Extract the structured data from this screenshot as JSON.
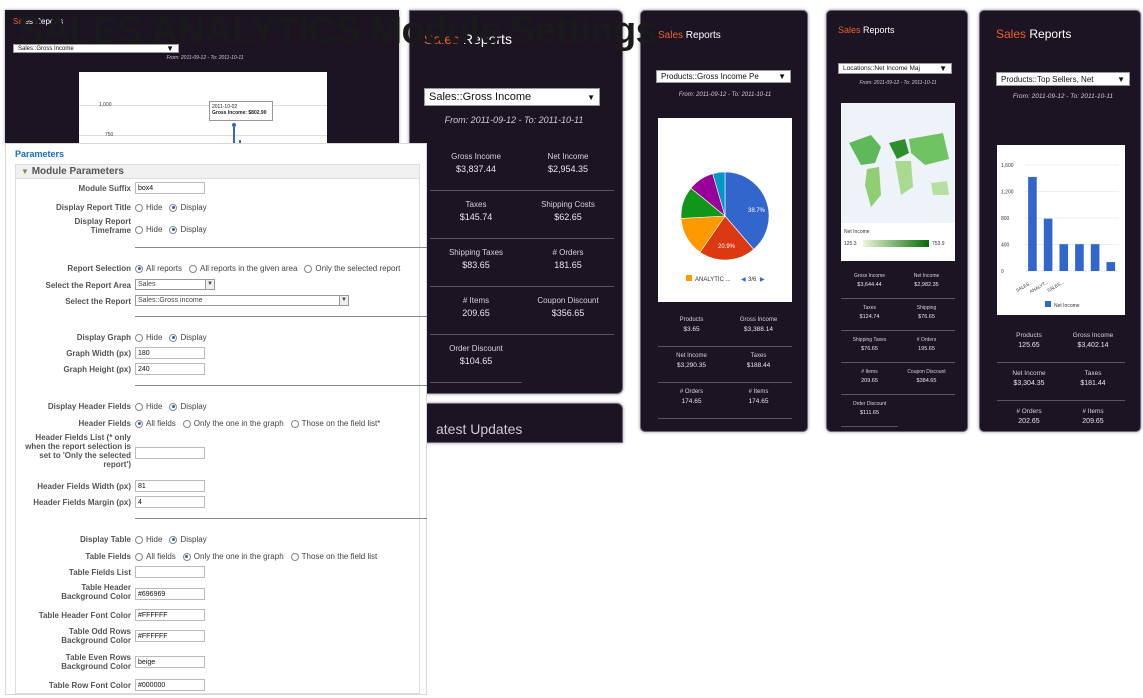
{
  "page_title": "SALES ANALYTICS Module Settings",
  "shot1": {
    "title_accent": "Sal",
    "title_rest": "es Reports",
    "select": "Sales::Gross Income",
    "range": "From: 2011-09-12 - To: 2011-10-11",
    "y_tick_1": "1,000",
    "y_tick_2": "750",
    "tooltip_date": "2011-10-02",
    "tooltip_value": "Gross Income: $802.90"
  },
  "shot2": {
    "title_accent": "Sales",
    "title_rest": "Reports",
    "select": "Sales::Gross Income",
    "range": "From: 2011-09-12 - To: 2011-10-11",
    "stats": [
      {
        "label": "Gross Income",
        "value": "$3,837.44"
      },
      {
        "label": "Net Income",
        "value": "$2,954.35"
      },
      {
        "label": "Taxes",
        "value": "$145.74"
      },
      {
        "label": "Shipping Costs",
        "value": "$62.65"
      },
      {
        "label": "Shipping Taxes",
        "value": "$83.65"
      },
      {
        "label": "# Orders",
        "value": "181.65"
      },
      {
        "label": "# Items",
        "value": "209.65"
      },
      {
        "label": "Coupon Discount",
        "value": "$356.65"
      },
      {
        "label": "Order Discount",
        "value": "$104.65"
      }
    ],
    "next_title": "atest Updates"
  },
  "shot3": {
    "title_accent": "Sales",
    "title_rest": "Reports",
    "select": "Products::Gross Income Pe",
    "range": "From: 2011-09-12 - To: 2011-10-11",
    "pie_label_1": "38.7%",
    "pie_label_2": "20.9%",
    "legend": "ANALYTIC ...",
    "pager": "3/6",
    "pie_colors": [
      "#3366cc",
      "#dc3912",
      "#ff9900",
      "#109618",
      "#990099",
      "#0099c6"
    ],
    "stats": [
      {
        "label": "Products",
        "value": "$3.65"
      },
      {
        "label": "Gross Income",
        "value": "$3,388.14"
      },
      {
        "label": "Net Income",
        "value": "$3,290.35"
      },
      {
        "label": "Taxes",
        "value": "$188.44"
      },
      {
        "label": "# Orders",
        "value": "174.65"
      },
      {
        "label": "# Items",
        "value": "174.65"
      }
    ]
  },
  "shot4": {
    "title_accent": "Sales",
    "title_rest": "Reports",
    "select": "Locations::Net Income Maj",
    "range": "From: 2011-09-12 - To: 2011-10-11",
    "map_legend_title": "Net Income",
    "map_min": "125.3",
    "map_max": "753.9",
    "stats": [
      {
        "label": "Gross Income",
        "value": "$3,644.44"
      },
      {
        "label": "Net Income",
        "value": "$2,982.35"
      },
      {
        "label": "Taxes",
        "value": "$124.74"
      },
      {
        "label": "Shipping",
        "value": "$76.65"
      },
      {
        "label": "Shipping Taxes",
        "value": "$76.65"
      },
      {
        "label": "# Orders",
        "value": "195.65"
      },
      {
        "label": "# Items",
        "value": "209.65"
      },
      {
        "label": "Coupon Discount",
        "value": "$384.65"
      },
      {
        "label": "Order Discount",
        "value": "$111.65"
      }
    ]
  },
  "shot5": {
    "title_accent": "Sales",
    "title_rest": "Reports",
    "select": "Products::Top Sellers, Net",
    "range": "From: 2011-09-12 - To: 2011-10-11",
    "stats": [
      {
        "label": "Products",
        "value": "125.65"
      },
      {
        "label": "Gross Income",
        "value": "$3,402.14"
      },
      {
        "label": "Net Income",
        "value": "$3,304.35"
      },
      {
        "label": "Taxes",
        "value": "$181.44"
      },
      {
        "label": "# Orders",
        "value": "202.65"
      },
      {
        "label": "# Items",
        "value": "209.65"
      }
    ]
  },
  "chart_data": [
    {
      "type": "pie",
      "title": "",
      "labels": [
        "",
        "",
        "",
        "",
        "",
        ""
      ],
      "values": [
        38.7,
        20.9,
        14.5,
        11.8,
        9.6,
        4.5
      ],
      "data_labels": [
        "38.7%",
        "20.9%",
        "",
        "",
        "",
        ""
      ],
      "legend_visible": "ANALYTIC ..."
    },
    {
      "type": "bar",
      "title": "",
      "categories": [
        "SALES...",
        "ANALYT...",
        "SALES...",
        "",
        "",
        ""
      ],
      "series": [
        {
          "name": "Net Income",
          "values": [
            1420,
            790,
            405,
            405,
            405,
            135
          ]
        }
      ],
      "yticks": [
        "1,600",
        "1,200",
        "800",
        "400",
        "0"
      ],
      "ylim": [
        0,
        1600
      ],
      "grid": true,
      "legend": "bottom"
    }
  ],
  "form": {
    "section_label": "Parameters",
    "group_label": "Module Parameters",
    "module_suffix_label": "Module Suffix",
    "module_suffix_value": "box4",
    "display_title_label": "Display Report Title",
    "hide": "Hide",
    "display": "Display",
    "display_timeframe_label": "Display Report Timeframe",
    "report_selection_label": "Report Selection",
    "all_reports": "All reports",
    "all_reports_area": "All reports in the given area",
    "only_selected": "Only the selected report",
    "area_label": "Select the Report Area",
    "area_value": "Sales",
    "report_label": "Select the Report",
    "report_value": "Sales::Gross income",
    "display_graph_label": "Display Graph",
    "graph_width_label": "Graph Width (px)",
    "graph_width_value": "180",
    "graph_height_label": "Graph Height (px)",
    "graph_height_value": "240",
    "display_header_label": "Display Header Fields",
    "header_fields_label": "Header Fields",
    "all_fields": "All fields",
    "only_graph": "Only the one in the graph",
    "field_list_star": "Those on the field list*",
    "field_list": "Those on the field list",
    "header_list_label": "Header Fields List (* only when the report selection is set to 'Only the selected report')",
    "header_width_label": "Header Fields Width (px)",
    "header_width_value": "81",
    "header_margin_label": "Header Fields Margin (px)",
    "header_margin_value": "4",
    "display_table_label": "Display Table",
    "table_fields_label": "Table Fields",
    "table_fields_list_label": "Table Fields List",
    "th_bg_label": "Table Header Background Color",
    "th_bg_value": "#696969",
    "th_font_label": "Table Header Font Color",
    "th_font_value": "#FFFFFF",
    "odd_bg_label": "Table Odd Rows Background Color",
    "odd_bg_value": "#FFFFFF",
    "even_bg_label": "Table Even Rows Background Color",
    "even_bg_value": "beige",
    "row_font_label": "Table Row Font Color",
    "row_font_value": "#000000"
  }
}
